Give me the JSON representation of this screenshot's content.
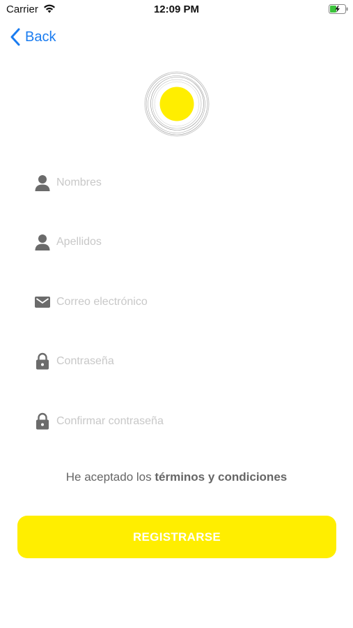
{
  "status_bar": {
    "carrier": "Carrier",
    "time": "12:09 PM"
  },
  "nav": {
    "back_label": "Back"
  },
  "form": {
    "fields": [
      {
        "placeholder": "Nombres",
        "icon": "person-icon",
        "value": ""
      },
      {
        "placeholder": "Apellidos",
        "icon": "person-icon",
        "value": ""
      },
      {
        "placeholder": "Correo electrónico",
        "icon": "envelope-icon",
        "value": ""
      },
      {
        "placeholder": "Contraseña",
        "icon": "lock-icon",
        "value": ""
      },
      {
        "placeholder": "Confirmar contraseña",
        "icon": "lock-icon",
        "value": ""
      }
    ]
  },
  "terms": {
    "prefix": "He aceptado los ",
    "link": "términos y condiciones"
  },
  "register_button": {
    "label": "REGISTRARSE"
  },
  "colors": {
    "accent_yellow": "#ffee00",
    "link_blue": "#1a7cf0",
    "icon_gray": "#6b6b6b",
    "placeholder_gray": "#c8c8c8"
  }
}
